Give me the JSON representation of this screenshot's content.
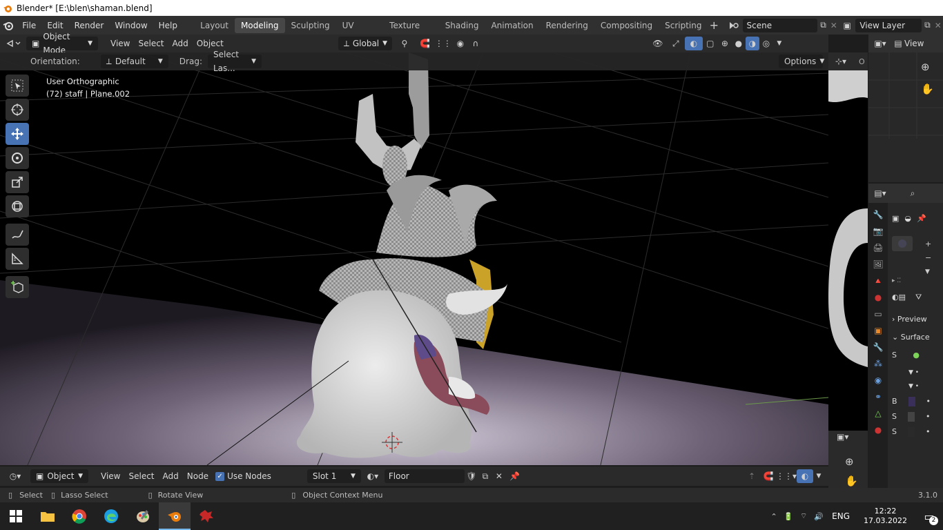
{
  "window": {
    "title": "Blender* [E:\\blen\\shaman.blend]"
  },
  "menu": [
    "File",
    "Edit",
    "Render",
    "Window",
    "Help"
  ],
  "workspaces": [
    "Layout",
    "Modeling",
    "Sculpting",
    "UV Editing",
    "Texture Paint",
    "Shading",
    "Animation",
    "Rendering",
    "Compositing",
    "Scripting"
  ],
  "active_workspace": "Modeling",
  "scene": {
    "name": "Scene",
    "view_layer": "View Layer"
  },
  "viewport_header": {
    "mode": "Object Mode",
    "menus": [
      "View",
      "Select",
      "Add",
      "Object"
    ],
    "transform_orientation": "Global"
  },
  "tool_settings": {
    "orientation_label": "Orientation:",
    "orientation_value": "Default",
    "drag_label": "Drag:",
    "drag_value": "Select Las...",
    "options_label": "Options"
  },
  "overlay_text": {
    "view_name": "User Orthographic",
    "object_info": "(72) staff | Plane.002"
  },
  "node_header": {
    "type": "Object",
    "menus": [
      "View",
      "Select",
      "Add",
      "Node"
    ],
    "use_nodes_label": "Use Nodes",
    "slot": "Slot 1",
    "material": "Floor"
  },
  "right_mini": {
    "view_label": "View",
    "o_label": "O"
  },
  "properties": {
    "preview": "Preview",
    "surface": "Surface",
    "row_labels": [
      "S",
      "B",
      "S",
      "S"
    ]
  },
  "status_bar": {
    "select": "Select",
    "lasso": "Lasso Select",
    "rotate": "Rotate View",
    "context_menu": "Object Context Menu",
    "version": "3.1.0"
  },
  "taskbar": {
    "lang": "ENG",
    "time": "12:22",
    "date": "17.03.2022",
    "notifications": "2"
  },
  "colors": {
    "accent": "#4772b3",
    "active_tab": "#474747",
    "header": "#303030"
  }
}
